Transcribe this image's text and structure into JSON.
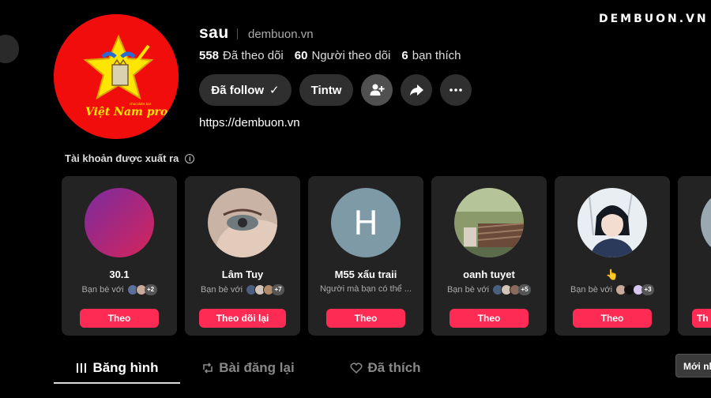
{
  "watermark": "DEMBUON.VN",
  "profile": {
    "username": "sau",
    "nickname": "dembuon.vn",
    "logo_text": "Việt Nam pro",
    "logo_small_text": "chocolate bar",
    "stats": [
      {
        "value": "558",
        "label": "Đã theo dõi"
      },
      {
        "value": "60",
        "label": "Người theo dõi"
      },
      {
        "value": "6",
        "label": "bạn thích"
      }
    ],
    "link": "https://dembuon.vn"
  },
  "actions": {
    "follow_label": "Đã follow",
    "follow_check": "✓",
    "message_label": "Tintw",
    "icons": [
      "add-friend-icon",
      "share-icon",
      "more-icon"
    ]
  },
  "suggestions": {
    "title": "Tài khoản được xuất ra",
    "info": "i",
    "cards": [
      {
        "name": "30.1",
        "mutual": "Bạn bè với",
        "extra": "+2",
        "button": "Theo"
      },
      {
        "name": "Lâm Tuy",
        "mutual": "Bạn bè với",
        "extra": "+7",
        "button": "Theo dõi lại"
      },
      {
        "name": "M55 xấu traii",
        "mutual": "Người mà bạn có thể ...",
        "avatar_letter": "H",
        "button": "Theo"
      },
      {
        "name": "oanh tuyet",
        "mutual": "Bạn bè với",
        "extra": "+5",
        "button": "Theo"
      },
      {
        "name": "👆",
        "mutual": "Bạn bè với",
        "extra": "+3",
        "button": "Theo"
      },
      {
        "button": "Th"
      }
    ]
  },
  "tabs": [
    {
      "label": "Băng hình",
      "icon": "video-grid-icon",
      "active": true
    },
    {
      "label": "Bài đăng lại",
      "icon": "repost-icon",
      "active": false
    },
    {
      "label": "Đã thích",
      "icon": "heart-icon",
      "active": false
    }
  ],
  "sort_chip": "Mới nhất",
  "colors": {
    "accent": "#fe2c55",
    "background": "#000000",
    "card": "#232323",
    "avatar_bg": "#f20d0d"
  }
}
